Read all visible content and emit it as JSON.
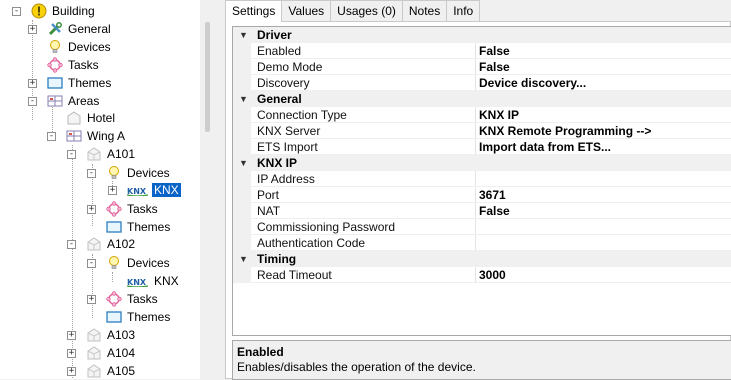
{
  "tree": {
    "nodes": [
      {
        "label": "Building",
        "icon": "building-icon"
      },
      {
        "label": "General",
        "icon": "tools-icon"
      },
      {
        "label": "Devices",
        "icon": "lightbulb-icon"
      },
      {
        "label": "Tasks",
        "icon": "tasks-icon"
      },
      {
        "label": "Themes",
        "icon": "themes-icon"
      },
      {
        "label": "Areas",
        "icon": "areas-icon"
      },
      {
        "label": "Hotel",
        "icon": "hotel-icon"
      },
      {
        "label": "Wing A",
        "icon": "areas-icon"
      },
      {
        "label": "A101",
        "icon": "room-icon"
      },
      {
        "label": "Devices",
        "icon": "lightbulb-icon"
      },
      {
        "label": "KNX",
        "icon": "knx-icon",
        "selected": true
      },
      {
        "label": "Tasks",
        "icon": "tasks-icon"
      },
      {
        "label": "Themes",
        "icon": "themes-icon"
      },
      {
        "label": "A102",
        "icon": "room-icon"
      },
      {
        "label": "Devices",
        "icon": "lightbulb-icon"
      },
      {
        "label": "KNX",
        "icon": "knx-icon"
      },
      {
        "label": "Tasks",
        "icon": "tasks-icon"
      },
      {
        "label": "Themes",
        "icon": "themes-icon"
      },
      {
        "label": "A103",
        "icon": "room-icon"
      },
      {
        "label": "A104",
        "icon": "room-icon"
      },
      {
        "label": "A105",
        "icon": "room-icon"
      }
    ]
  },
  "tabs": [
    "Settings",
    "Values",
    "Usages (0)",
    "Notes",
    "Info"
  ],
  "active_tab": "Settings",
  "grid": {
    "sections": [
      {
        "category": "Driver",
        "properties": [
          {
            "name": "Enabled",
            "value": "False"
          },
          {
            "name": "Demo Mode",
            "value": "False"
          },
          {
            "name": "Discovery",
            "value": "Device discovery..."
          }
        ]
      },
      {
        "category": "General",
        "properties": [
          {
            "name": "Connection Type",
            "value": "KNX IP"
          },
          {
            "name": "KNX Server",
            "value": "KNX Remote Programming -->"
          },
          {
            "name": "ETS Import",
            "value": "Import data from ETS..."
          }
        ]
      },
      {
        "category": "KNX IP",
        "properties": [
          {
            "name": "IP Address",
            "value": ""
          },
          {
            "name": "Port",
            "value": "3671"
          },
          {
            "name": "NAT",
            "value": "False"
          },
          {
            "name": "Commissioning Password",
            "value": ""
          },
          {
            "name": "Authentication Code",
            "value": ""
          }
        ]
      },
      {
        "category": "Timing",
        "properties": [
          {
            "name": "Read Timeout",
            "value": "3000"
          }
        ]
      }
    ]
  },
  "description": {
    "title": "Enabled",
    "text": "Enables/disables the operation of the device."
  },
  "colors": {
    "selection": "#0a64c8",
    "category_bg": "#f0f0f0",
    "knx_blue": "#1f5fa8",
    "knx_green": "#3a9c3a"
  }
}
